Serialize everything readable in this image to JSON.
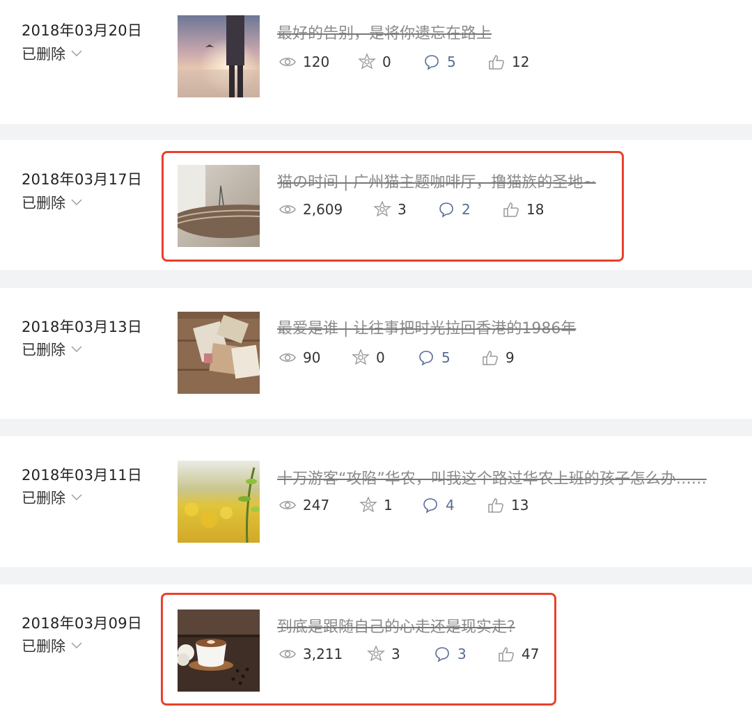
{
  "colors": {
    "page_bg": "#f2f3f5",
    "card_bg": "#ffffff",
    "title_deleted": "#8a8a8a",
    "comment_accent": "#576b95",
    "highlight_border": "#e8412c"
  },
  "articles": [
    {
      "date": "2018年03月20日",
      "status": "已删除",
      "title": "最好的告别，是将你遗忘在路上",
      "views": "120",
      "shares": "0",
      "comments": "5",
      "likes": "12",
      "thumbnail": "beach-sunset-photo",
      "highlighted": false
    },
    {
      "date": "2018年03月17日",
      "status": "已删除",
      "title": "猫の时间 | 广州猫主题咖啡厅，撸猫族的圣地~",
      "views": "2,609",
      "shares": "3",
      "comments": "2",
      "likes": "18",
      "thumbnail": "cat-scratcher-photo",
      "highlighted": true
    },
    {
      "date": "2018年03月13日",
      "status": "已删除",
      "title": "最爱是谁 | 让往事把时光拉回香港的1986年",
      "views": "90",
      "shares": "0",
      "comments": "5",
      "likes": "9",
      "thumbnail": "old-letters-photo",
      "highlighted": false
    },
    {
      "date": "2018年03月11日",
      "status": "已删除",
      "title": "十万游客“攻陷”华农，叫我这个路过华农上班的孩子怎么办……",
      "views": "247",
      "shares": "1",
      "comments": "4",
      "likes": "13",
      "thumbnail": "yellow-flowers-photo",
      "highlighted": false
    },
    {
      "date": "2018年03月09日",
      "status": "已删除",
      "title": "到底是跟随自己的心走还是现实走?",
      "views": "3,211",
      "shares": "3",
      "comments": "3",
      "likes": "47",
      "thumbnail": "coffee-cup-photo",
      "highlighted": true
    }
  ]
}
